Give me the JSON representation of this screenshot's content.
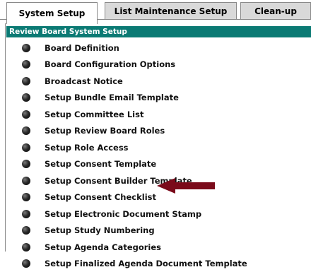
{
  "tabs": [
    {
      "label": "System Setup",
      "active": true
    },
    {
      "label": "List Maintenance Setup",
      "active": false
    },
    {
      "label": "Clean-up",
      "active": false
    }
  ],
  "panel": {
    "title": "Review Board System Setup",
    "items": [
      {
        "label": "Board Definition"
      },
      {
        "label": "Board Configuration Options"
      },
      {
        "label": "Broadcast Notice"
      },
      {
        "label": "Setup Bundle Email Template"
      },
      {
        "label": "Setup Committee List"
      },
      {
        "label": "Setup Review Board Roles"
      },
      {
        "label": "Setup Role Access"
      },
      {
        "label": "Setup Consent Template"
      },
      {
        "label": "Setup Consent Builder Template"
      },
      {
        "label": "Setup Consent Checklist"
      },
      {
        "label": "Setup Electronic Document Stamp"
      },
      {
        "label": "Setup Study Numbering"
      },
      {
        "label": "Setup Agenda Categories"
      },
      {
        "label": "Setup Finalized Agenda Document Template"
      }
    ]
  },
  "colors": {
    "header_bg": "#0b7a74",
    "arrow": "#7a0a1a"
  },
  "annotation": {
    "icon": "left-arrow-icon",
    "points_to": "Setup Consent Checklist"
  }
}
